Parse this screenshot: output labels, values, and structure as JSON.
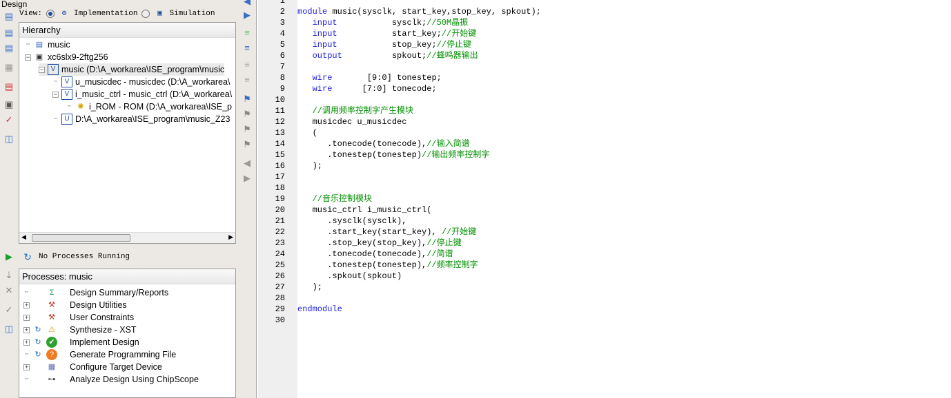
{
  "design_panel": {
    "title": "Design",
    "view_label": "View:",
    "view_options": [
      {
        "label": "Implementation",
        "selected": true
      },
      {
        "label": "Simulation",
        "selected": false
      }
    ],
    "hierarchy_title": "Hierarchy",
    "tree": [
      {
        "label": "music",
        "icon": "project-icon",
        "expander": "",
        "indent": 0
      },
      {
        "label": "xc6slx9-2ftg256",
        "icon": "chip-icon",
        "expander": "-",
        "indent": 0
      },
      {
        "label": "music (D:\\A_workarea\\ISE_program\\music",
        "icon": "verilog-top-icon",
        "expander": "-",
        "indent": 1,
        "selected": true
      },
      {
        "label": "u_musicdec - musicdec (D:\\A_workarea\\",
        "icon": "verilog-file-icon",
        "expander": "",
        "indent": 2
      },
      {
        "label": "i_music_ctrl - music_ctrl (D:\\A_workarea\\",
        "icon": "verilog-file-icon",
        "expander": "-",
        "indent": 2
      },
      {
        "label": "i_ROM - ROM (D:\\A_workarea\\ISE_p",
        "icon": "ip-core-icon",
        "expander": "",
        "indent": 3
      },
      {
        "label": "D:\\A_workarea\\ISE_program\\music_Z23",
        "icon": "ucf-file-icon",
        "expander": "",
        "indent": 2
      }
    ]
  },
  "process_panel": {
    "status": "No Processes Running",
    "title": "Processes: music",
    "items": [
      {
        "label": "Design Summary/Reports",
        "icon": "sigma-icon",
        "expander": ""
      },
      {
        "label": "Design Utilities",
        "icon": "tools-icon",
        "expander": "+"
      },
      {
        "label": "User Constraints",
        "icon": "tools-icon",
        "expander": "+"
      },
      {
        "label": "Synthesize - XST",
        "icon": "warning-icon",
        "expander": "+"
      },
      {
        "label": "Implement Design",
        "icon": "check-icon",
        "expander": "+"
      },
      {
        "label": "Generate Programming File",
        "icon": "question-icon",
        "expander": ""
      },
      {
        "label": "Configure Target Device",
        "icon": "device-icon",
        "expander": "+"
      },
      {
        "label": "Analyze Design Using ChipScope",
        "icon": "chipscope-icon",
        "expander": ""
      }
    ]
  },
  "colors": {
    "keyword": "#2222dd",
    "comment": "#009000"
  },
  "code": [
    [],
    [
      {
        "t": "module",
        "c": "kw"
      },
      {
        "t": " music(sysclk, start_key,stop_key, spkout);"
      }
    ],
    [
      {
        "t": "   "
      },
      {
        "t": "input",
        "c": "kw"
      },
      {
        "t": "           sysclk;"
      },
      {
        "t": "//50M晶振",
        "c": "cm"
      }
    ],
    [
      {
        "t": "   "
      },
      {
        "t": "input",
        "c": "kw"
      },
      {
        "t": "           start_key;"
      },
      {
        "t": "//开始键",
        "c": "cm"
      }
    ],
    [
      {
        "t": "   "
      },
      {
        "t": "input",
        "c": "kw"
      },
      {
        "t": "           stop_key;"
      },
      {
        "t": "//停止键",
        "c": "cm"
      }
    ],
    [
      {
        "t": "   "
      },
      {
        "t": "output",
        "c": "kw"
      },
      {
        "t": "          spkout;"
      },
      {
        "t": "//蜂鸣器输出",
        "c": "cm"
      }
    ],
    [],
    [
      {
        "t": "   "
      },
      {
        "t": "wire",
        "c": "kw"
      },
      {
        "t": "       [9:0] tonestep;"
      }
    ],
    [
      {
        "t": "   "
      },
      {
        "t": "wire",
        "c": "kw"
      },
      {
        "t": "      [7:0] tonecode;"
      }
    ],
    [],
    [
      {
        "t": "   "
      },
      {
        "t": "//调用频率控制字产生模块",
        "c": "cm"
      }
    ],
    [
      {
        "t": "   musicdec u_musicdec"
      }
    ],
    [
      {
        "t": "   ("
      }
    ],
    [
      {
        "t": "      .tonecode(tonecode),"
      },
      {
        "t": "//输入简谱",
        "c": "cm"
      }
    ],
    [
      {
        "t": "      .tonestep(tonestep)"
      },
      {
        "t": "//输出频率控制字",
        "c": "cm"
      }
    ],
    [
      {
        "t": "   );"
      }
    ],
    [],
    [],
    [
      {
        "t": "   "
      },
      {
        "t": "//音乐控制模块",
        "c": "cm"
      }
    ],
    [
      {
        "t": "   music_ctrl i_music_ctrl("
      }
    ],
    [
      {
        "t": "      .sysclk(sysclk),"
      }
    ],
    [
      {
        "t": "      .start_key(start_key), "
      },
      {
        "t": "//开始键",
        "c": "cm"
      }
    ],
    [
      {
        "t": "      .stop_key(stop_key),"
      },
      {
        "t": "//停止键",
        "c": "cm"
      }
    ],
    [
      {
        "t": "      .tonecode(tonecode),"
      },
      {
        "t": "//简谱",
        "c": "cm"
      }
    ],
    [
      {
        "t": "      .tonestep(tonestep),"
      },
      {
        "t": "//频率控制字",
        "c": "cm"
      }
    ],
    [
      {
        "t": "      .spkout(spkout)"
      }
    ],
    [
      {
        "t": "   );"
      }
    ],
    [],
    [
      {
        "t": "endmodule",
        "c": "kw"
      }
    ],
    []
  ]
}
